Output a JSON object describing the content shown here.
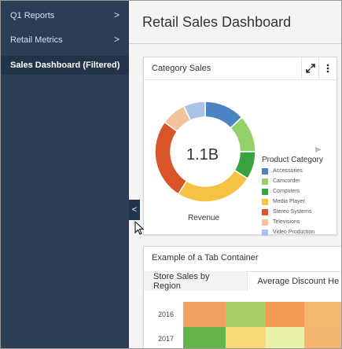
{
  "sidebar": {
    "items": [
      {
        "label": "Q1 Reports",
        "has_chevron": true
      },
      {
        "label": "Retail Metrics",
        "has_chevron": true
      },
      {
        "label": "Sales Dashboard (Filtered)",
        "has_chevron": false
      }
    ],
    "chevron_glyph": ">",
    "collapse_glyph": "<"
  },
  "header": {
    "title": "Retail Sales Dashboard"
  },
  "category_card": {
    "title": "Category Sales",
    "expand_icon": "expand-icon",
    "menu_icon": "kebab-menu-icon",
    "chart_center_value": "1.1B",
    "chart_label": "Revenue"
  },
  "tab_container": {
    "title": "Example of a Tab Container",
    "tabs": [
      {
        "label": "Store Sales by Region",
        "active": false
      },
      {
        "label": "Average Discount He",
        "active": true
      }
    ],
    "years": [
      "2016",
      "2017"
    ],
    "heat_colors": [
      [
        "#f0a060",
        "#a7cf6a",
        "#f39a55",
        "#f4b86f"
      ],
      [
        "#64b648",
        "#f7d97a",
        "#eaf1a8",
        "#f3b56f"
      ]
    ]
  },
  "chart_data": {
    "type": "pie",
    "title": "Category Sales",
    "legend_title": "Product Category",
    "center_label": "1.1B",
    "xlabel": "Revenue",
    "legend_position": "right",
    "categories": [
      "Accessories",
      "Camcorder",
      "Computers",
      "Media Player",
      "Stereo Systems",
      "Televisions",
      "Video Production"
    ],
    "values": [
      13,
      12,
      9,
      25,
      26,
      8,
      7
    ],
    "colors": [
      "#4a84c4",
      "#94d16a",
      "#36a33e",
      "#f6c244",
      "#d9532b",
      "#f1c29b",
      "#a9c4e6"
    ]
  }
}
